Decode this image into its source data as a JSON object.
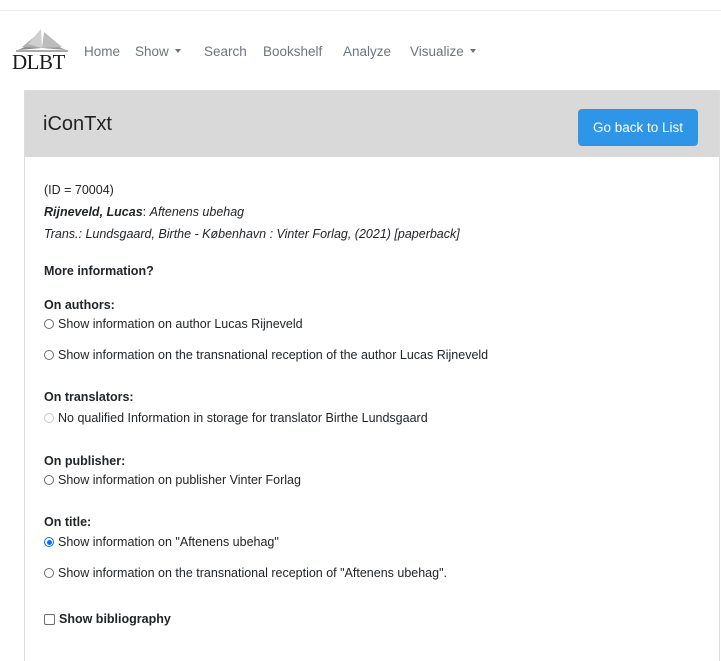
{
  "nav": {
    "logo_text": "DLBT",
    "items": [
      {
        "label": "Home",
        "dropdown": false
      },
      {
        "label": "Show",
        "dropdown": true
      },
      {
        "label": "Search",
        "dropdown": false
      },
      {
        "label": "Bookshelf",
        "dropdown": false
      },
      {
        "label": "Analyze",
        "dropdown": false
      },
      {
        "label": "Visualize",
        "dropdown": true
      }
    ]
  },
  "card": {
    "title": "iConTxt",
    "back_button": "Go back to List"
  },
  "record": {
    "id_line": "(ID = 70004)",
    "author": "Rijneveld, Lucas",
    "title_sep": ": ",
    "title": "Aftenens ubehag",
    "trans_line": "Trans.: Lundsgaard, Birthe - København : Vinter Forlag, (2021) [paperback]"
  },
  "more_info": "More information?",
  "sections": {
    "authors": {
      "heading": "On authors:",
      "options": [
        "Show information on author Lucas Rijneveld",
        "Show information on the transnational reception of the author Lucas Rijneveld"
      ]
    },
    "translators": {
      "heading": "On translators:",
      "options": [
        "No qualified Information in storage for translator Birthe Lundsgaard"
      ]
    },
    "publisher": {
      "heading": "On publisher:",
      "options": [
        "Show information on publisher Vinter Forlag"
      ]
    },
    "title": {
      "heading": "On title:",
      "options": [
        "Show information on \"Aftenens ubehag\"",
        "Show information on the transnational reception of \"Aftenens ubehag\"."
      ]
    }
  },
  "bibliography": "Show bibliography",
  "colors": {
    "button": "#2f95e6",
    "header": "#d9d9d9",
    "radio_checked": "#0d6efd"
  }
}
